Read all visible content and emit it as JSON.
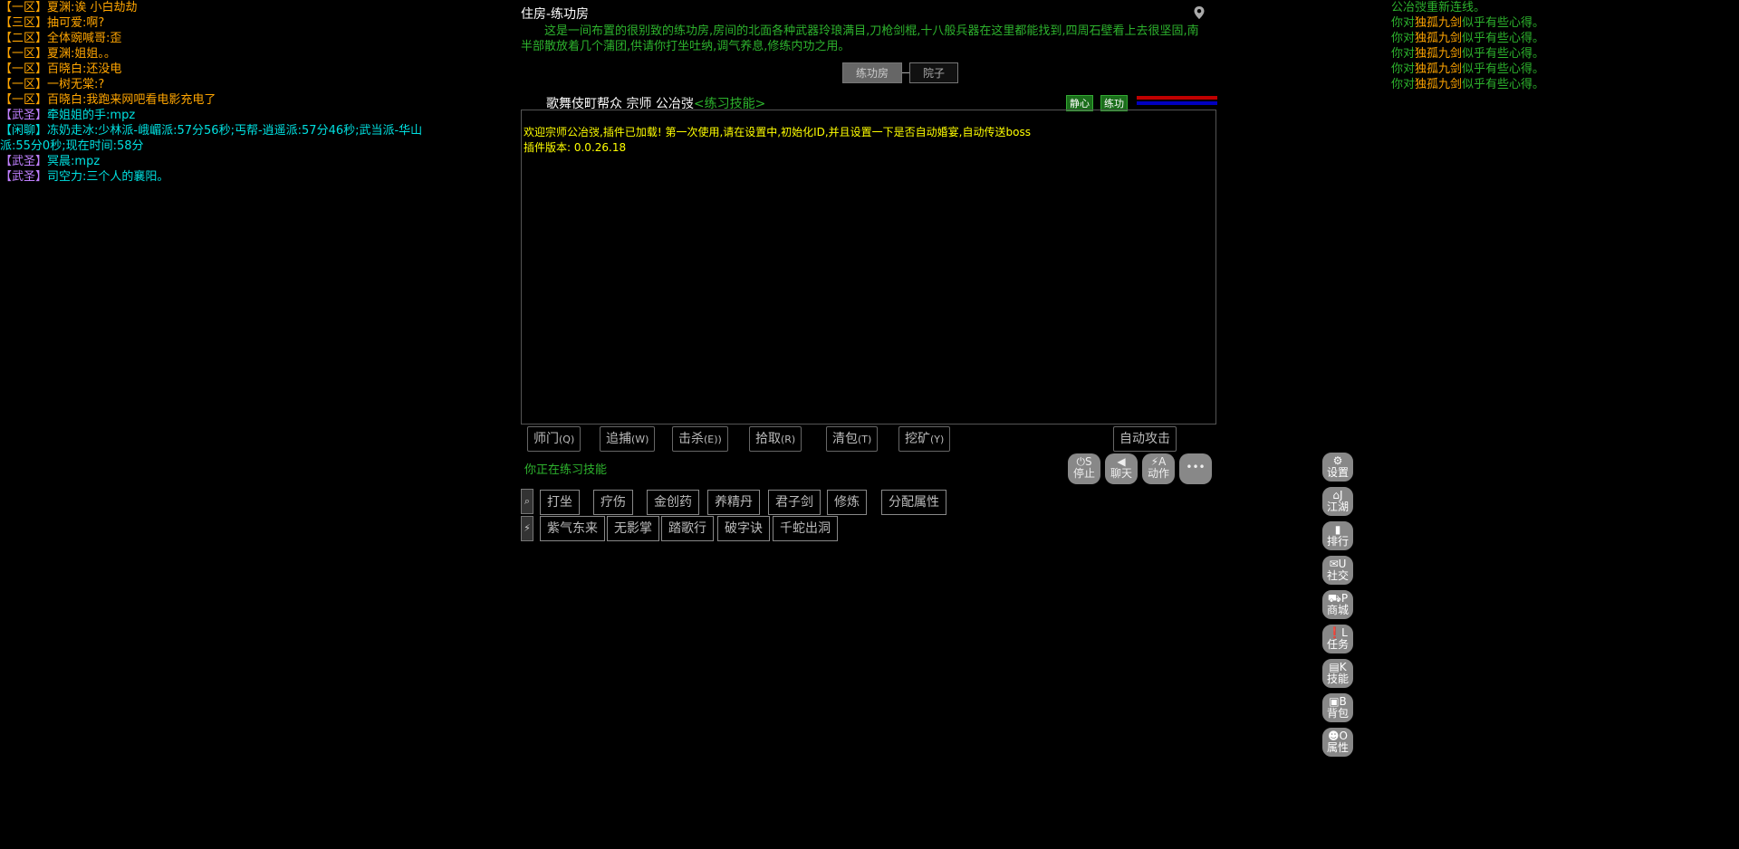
{
  "chat_left": [
    {
      "tag": "【一区】",
      "name": "夏渊",
      "text": "诶 小白劫劫",
      "style": "yellow"
    },
    {
      "tag": "【三区】",
      "name": "抽可爱",
      "text": "啊?",
      "style": "yellow"
    },
    {
      "tag": "【二区】",
      "name": "全体豌喊哥",
      "text": "歪",
      "style": "yellow"
    },
    {
      "tag": "【一区】",
      "name": "夏渊",
      "text": "姐姐。。",
      "style": "yellow"
    },
    {
      "tag": "【一区】",
      "name": "百晓白",
      "text": "还没电",
      "style": "yellow"
    },
    {
      "tag": "【一区】",
      "name": "一树无棠",
      "text": "?",
      "style": "yellow"
    },
    {
      "tag": "【一区】",
      "name": "百晓白",
      "text": "我跑来网吧看电影充电了",
      "style": "yellow"
    },
    {
      "tag": "【武圣】",
      "name": "牵姐姐的手",
      "text": "mpz",
      "style": "purple"
    },
    {
      "tag": "【闲聊】",
      "name": "冻奶走冰",
      "text": "少林派-峨嵋派:57分56秒;丐帮-逍遥派:57分46秒;武当派-华山派:55分0秒;现在时间:58分",
      "style": "cyan"
    },
    {
      "tag": "【武圣】",
      "name": "冥晨",
      "text": "mpz",
      "style": "purple"
    },
    {
      "tag": "【武圣】",
      "name": "司空力",
      "text": "三个人的襄阳。",
      "style": "purple"
    }
  ],
  "right_log": {
    "reconnect": "公冶弢重新连线。",
    "lines": [
      {
        "prefix": "你对",
        "skill": "独孤九剑",
        "suffix": "似乎有些心得。"
      },
      {
        "prefix": "你对",
        "skill": "独孤九剑",
        "suffix": "似乎有些心得。"
      },
      {
        "prefix": "你对",
        "skill": "独孤九剑",
        "suffix": "似乎有些心得。"
      },
      {
        "prefix": "你对",
        "skill": "独孤九剑",
        "suffix": "似乎有些心得。"
      },
      {
        "prefix": "你对",
        "skill": "独孤九剑",
        "suffix": "似乎有些心得。"
      }
    ]
  },
  "room": {
    "title": "住房-练功房",
    "description": "这是一间布置的很别致的练功房,房间的北面各种武器玲琅满目,刀枪剑棍,十八般兵器在这里都能找到,四周石壁看上去很坚固,南半部散放着几个蒲团,供请你打坐吐纳,调气养息,修练内功之用。",
    "exits": [
      "练功房",
      "院子"
    ]
  },
  "status": {
    "prefix": "歌舞伎町帮众 宗师 公冶弢",
    "skill_label": "<练习技能>",
    "badge1": "静心",
    "badge2": "练功"
  },
  "output": [
    "欢迎宗师公冶弢,插件已加载! 第一次使用,请在设置中,初始化ID,并且设置一下是否自动婚宴,自动传送boss",
    "插件版本: 0.0.26.18"
  ],
  "actions": [
    {
      "label": "师门",
      "key": "(Q)"
    },
    {
      "label": "追捕",
      "key": "(W)"
    },
    {
      "label": "击杀",
      "key": "(E))"
    },
    {
      "label": "拾取",
      "key": "(R)"
    },
    {
      "label": "清包",
      "key": "(T)"
    },
    {
      "label": "挖矿",
      "key": "(Y)"
    }
  ],
  "auto_attack": "自动攻击",
  "practice_status": "你正在练习技能",
  "round_buttons": [
    {
      "icon": "⏻",
      "key": "S",
      "label": "停止"
    },
    {
      "icon": "◀",
      "key": "",
      "label": "聊天"
    },
    {
      "icon": "⚡",
      "key": "A",
      "label": "动作"
    },
    {
      "icon": "•••",
      "key": "",
      "label": ""
    }
  ],
  "skills_row1": [
    "打坐",
    "疗伤",
    "金创药",
    "养精丹",
    "君子剑",
    "修炼",
    "分配属性"
  ],
  "skills_row2": [
    "紫气东来",
    "无影掌",
    "踏歌行",
    "破字诀",
    "千蛇出洞"
  ],
  "sidebar": [
    {
      "icon": "⚙",
      "key": "",
      "label": "设置"
    },
    {
      "icon": "⌂",
      "key": "J",
      "label": "江湖"
    },
    {
      "icon": "▮",
      "key": "",
      "label": "排行"
    },
    {
      "icon": "✉",
      "key": "U",
      "label": "社交"
    },
    {
      "icon": "⛟",
      "key": "P",
      "label": "商城"
    },
    {
      "icon": "❗",
      "key": "L",
      "label": "任务"
    },
    {
      "icon": "▤",
      "key": "K",
      "label": "技能"
    },
    {
      "icon": "▣",
      "key": "B",
      "label": "背包"
    },
    {
      "icon": "☻",
      "key": "O",
      "label": "属性"
    }
  ],
  "colors": {
    "hp": "#c00000",
    "mp": "#0000c0",
    "accent": "#2db32d"
  }
}
